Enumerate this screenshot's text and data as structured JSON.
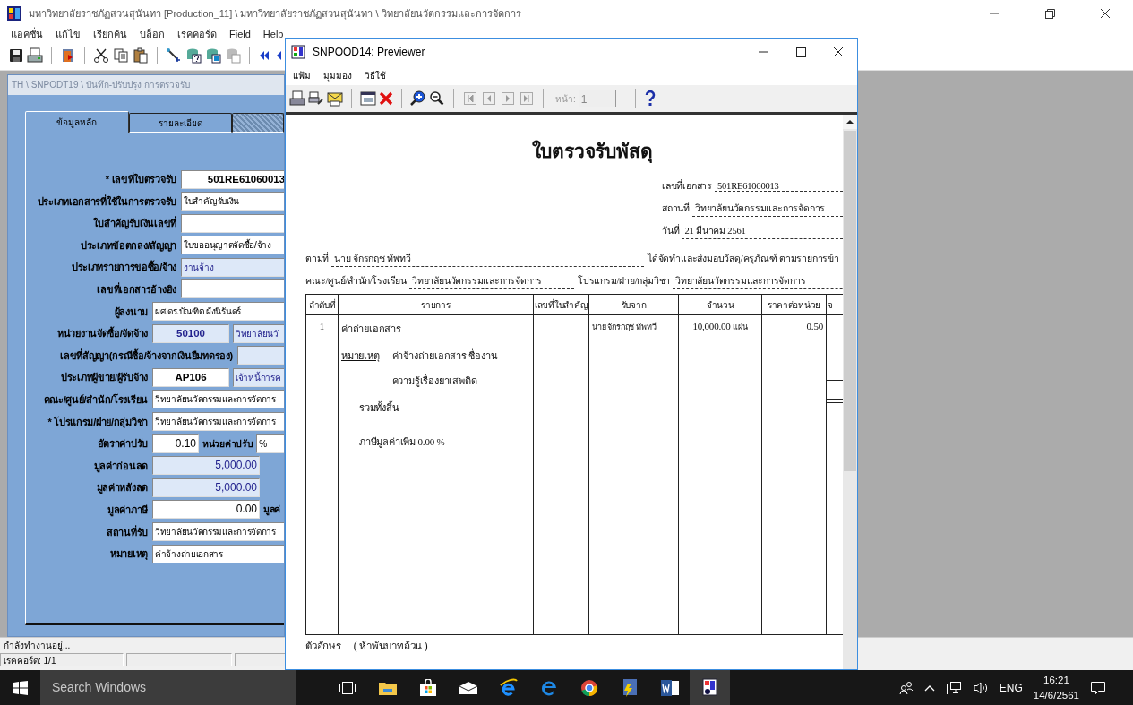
{
  "main_window": {
    "title": "มหาวิทยาลัยราชภัฏสวนสุนันทา [Production_11] \\ มหาวิทยาลัยราชภัฏสวนสุนันทา \\ วิทยาลัยนวัตกรรมและการจัดการ",
    "menu": [
      "แอคชั่น",
      "แก้ไข",
      "เรียกค้น",
      "บล็อก",
      "เรคคอร์ด",
      "Field",
      "Help"
    ]
  },
  "form_window": {
    "title": "TH \\ SNPODT19 \\ บันทึก-ปรับปรุง การตรวจรับ",
    "tabs": [
      {
        "label": "ข้อมูลหลัก",
        "selected": true
      },
      {
        "label": "รายละเอียด",
        "selected": false
      }
    ],
    "rows": [
      {
        "label": "* เลขที่ใบตรวจรับ",
        "fields": [
          {
            "kind": "code",
            "readonly": false,
            "value": "501RE61060013"
          }
        ]
      },
      {
        "label": "ประเภทเอกสารที่ใช้ในการตรวจรับ",
        "fields": [
          {
            "kind": "text",
            "readonly": false,
            "value": "ใบสำคัญรับเงิน"
          }
        ]
      },
      {
        "label": "ใบสำคัญรับเงินเลขที่",
        "fields": [
          {
            "kind": "text",
            "readonly": false
          }
        ]
      },
      {
        "label": "ประเภทข้อตกลง/สัญญา",
        "fields": [
          {
            "kind": "text",
            "readonly": false,
            "value": "ใบขออนุญาตจัดซื้อ/จ้าง"
          }
        ]
      },
      {
        "label": "ประเภทรายการขอซื้อ/จ้าง",
        "fields": [
          {
            "kind": "text",
            "readonly": true,
            "value": "งานจ้าง"
          }
        ]
      },
      {
        "label": "เลขที่เอกสารอ้างอิง",
        "fields": [
          {
            "kind": "text",
            "readonly": false
          }
        ]
      },
      {
        "label": "ผู้ลงนาม",
        "fields": [
          {
            "kind": "text",
            "readonly": false,
            "value": "ผศ.ดร.บัณฑิต  ผังนิรันดร์"
          }
        ]
      },
      {
        "label": "หน่วยงานจัดซื้อ/จัดจ้าง",
        "fields": [
          {
            "kind": "code",
            "readonly": true,
            "value": "50100"
          },
          {
            "kind": "text",
            "readonly": true,
            "value": "วิทยาลัยนวั"
          }
        ]
      },
      {
        "label": "เลขที่สัญญา(กรณีซื้อ/จ้างจากเงินยืมทดรอง)",
        "fields": [
          {
            "kind": "text",
            "readonly": true
          }
        ]
      },
      {
        "label": "ประเภทผู้ขาย/ผู้รับจ้าง",
        "fields": [
          {
            "kind": "code",
            "readonly": false,
            "value": "AP106"
          },
          {
            "kind": "text",
            "readonly": true,
            "value": "เจ้าหนี้การค"
          }
        ]
      },
      {
        "label": "คณะ/ศูนย์/สำนัก/โรงเรียน",
        "fields": [
          {
            "kind": "text",
            "readonly": false,
            "value": "วิทยาลัยนวัตกรรมและการจัดการ"
          }
        ]
      },
      {
        "label": "* โปรแกรม/ฝ่าย/กลุ่มวิชา",
        "fields": [
          {
            "kind": "text",
            "readonly": false,
            "value": "วิทยาลัยนวัตกรรมและการจัดการ"
          }
        ]
      },
      {
        "label": "อัตราค่าปรับ",
        "fields": [
          {
            "kind": "number",
            "readonly": false,
            "value": "0.10"
          },
          {
            "kind": "label",
            "value": "หน่วยค่าปรับ"
          },
          {
            "kind": "text",
            "readonly": false,
            "value": "%"
          }
        ]
      },
      {
        "label": "มูลค่าก่อนลด",
        "fields": [
          {
            "kind": "number",
            "readonly": true,
            "value": "5,000.00"
          }
        ]
      },
      {
        "label": "มูลค่าหลังลด",
        "fields": [
          {
            "kind": "number",
            "readonly": true,
            "value": "5,000.00"
          }
        ]
      },
      {
        "label": "มูลค่าภาษี",
        "fields": [
          {
            "kind": "number",
            "readonly": false,
            "value": "0.00"
          },
          {
            "kind": "label",
            "value": "มูลค่"
          }
        ]
      },
      {
        "label": "สถานที่รับ",
        "fields": [
          {
            "kind": "text",
            "readonly": false,
            "value": "วิทยาลัยนวัตกรรมและการจัดการ"
          }
        ]
      },
      {
        "label": "หมายเหตุ",
        "fields": [
          {
            "kind": "text",
            "readonly": false,
            "value": "ค่าจ้างถ่ายเอกสาร"
          }
        ]
      }
    ]
  },
  "status_bar": {
    "message": "กำลังทำงานอยู่...",
    "record": "เรคคอร์ด: 1/1"
  },
  "previewer": {
    "title": "SNPOOD14: Previewer",
    "menu": [
      "แฟ้ม",
      "มุมมอง",
      "วิธีใช้"
    ],
    "page_label": "หน้า:",
    "page_value": "1",
    "document": {
      "title": "ใบตรวจรับพัสดุ",
      "header_fields": [
        {
          "label": "เลขที่เอกสาร",
          "value": "501RE61060013"
        },
        {
          "label": "สถานที่",
          "value": "วิทยาลัยนวัตกรรมและการจัดการ"
        },
        {
          "label": "วันที่",
          "value": "21 มีนาคม 2561"
        }
      ],
      "according_to": {
        "label": "ตามที่",
        "value": "นาย จักรกฤช ทัพทวี",
        "text": "ได้จัดทำและส่งมอบวัสดุ/ครุภัณฑ์ ตามรายการข้า"
      },
      "org_fields": [
        {
          "label": "คณะ/ศูนย์/สำนัก/โรงเรียน",
          "value": "วิทยาลัยนวัตกรรมและการจัดการ"
        },
        {
          "label": "โปรแกรม/ฝ่าย/กลุ่มวิชา",
          "value": "วิทยาลัยนวัตกรรมและการจัดการ"
        }
      ],
      "table": {
        "columns": [
          "ลำดับที่",
          "รายการ",
          "เลขที่ใบสำคัญ",
          "รับจาก",
          "จำนวน",
          "ราคาต่อหน่วย",
          "จ"
        ],
        "rows": [
          {
            "no": "1",
            "item": "ค่าถ่ายเอกสาร",
            "note_label": "หมายเหตุ",
            "note_lines": [
              "ค่าจ้างถ่ายเอกสาร ชื่องาน",
              "ความรู้เรื่องยาเสพติด"
            ],
            "total_label": "รวมทั้งสิ้น",
            "vat": "ภาษีมูลค่าเพิ่ม 0.00 %",
            "from": "นาย จักรกฤช ทัพทวี",
            "quantity": "10,000.00",
            "unit": "แผ่น",
            "unit_price": "0.50"
          }
        ]
      },
      "amount_words": {
        "label": "ตัวอักษร",
        "value": "( ห้าพันบาทถ้วน )"
      }
    }
  },
  "taskbar": {
    "search_placeholder": "Search Windows",
    "language": "ENG",
    "time": "16:21",
    "date": "14/6/2561"
  }
}
